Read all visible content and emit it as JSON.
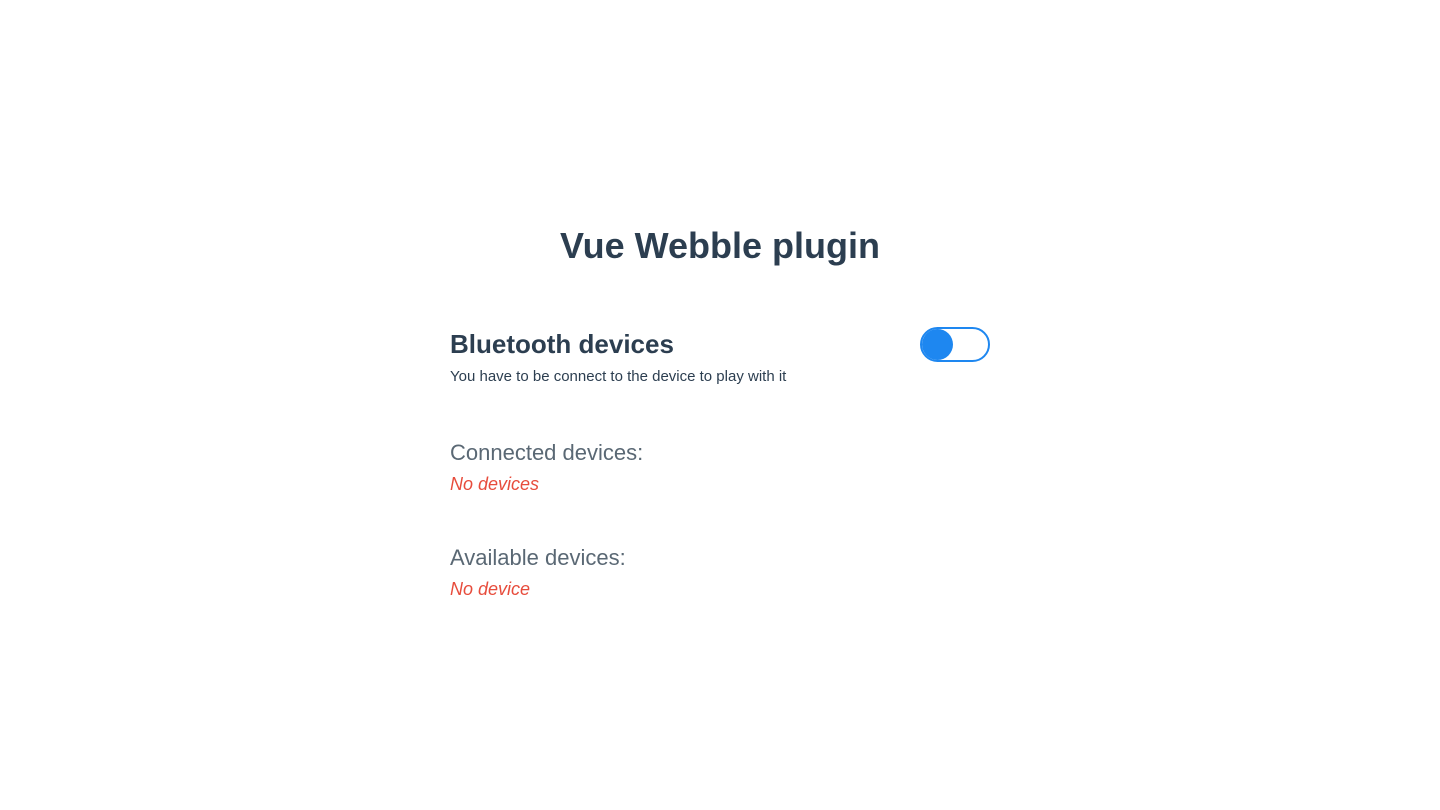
{
  "page": {
    "title": "Vue Webble plugin"
  },
  "bluetooth": {
    "title": "Bluetooth devices",
    "subtitle": "You have to be connect to the device to play with it",
    "toggle_on": true
  },
  "connected": {
    "label": "Connected devices:",
    "empty_text": "No devices"
  },
  "available": {
    "label": "Available devices:",
    "empty_text": "No device"
  }
}
